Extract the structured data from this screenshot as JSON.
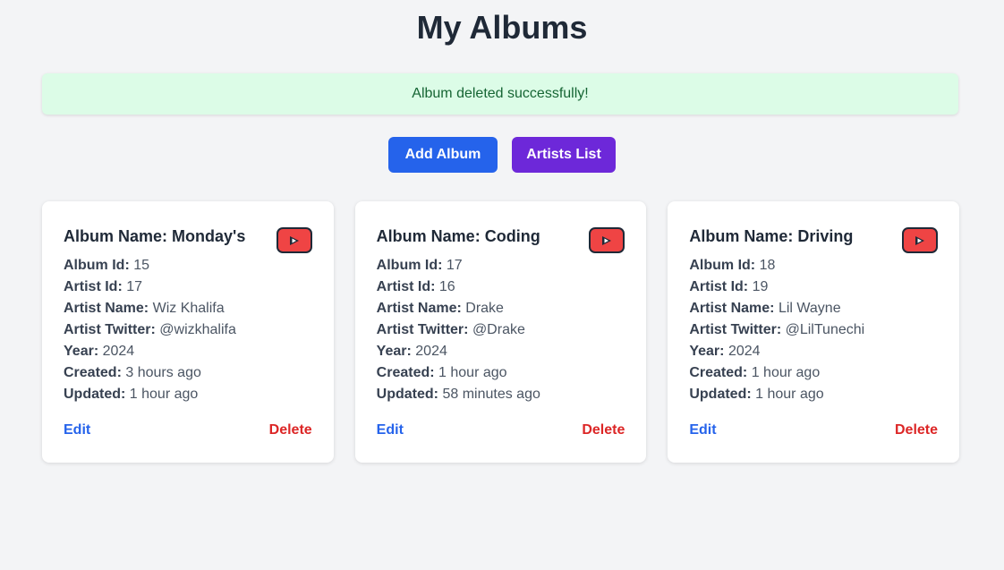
{
  "header": {
    "title": "My Albums"
  },
  "alert": {
    "message": "Album deleted successfully!"
  },
  "actions": {
    "add_album": "Add Album",
    "artists_list": "Artists List"
  },
  "labels": {
    "album_name": "Album Name:",
    "album_id": "Album Id:",
    "artist_id": "Artist Id:",
    "artist_name": "Artist Name:",
    "artist_twitter": "Artist Twitter:",
    "year": "Year:",
    "created": "Created:",
    "updated": "Updated:",
    "edit": "Edit",
    "delete": "Delete"
  },
  "albums": [
    {
      "name": "Monday's",
      "album_id": "15",
      "artist_id": "17",
      "artist_name": "Wiz Khalifa",
      "artist_twitter": "@wizkhalifa",
      "year": "2024",
      "created": "3 hours ago",
      "updated": "1 hour ago"
    },
    {
      "name": "Coding",
      "album_id": "17",
      "artist_id": "16",
      "artist_name": "Drake",
      "artist_twitter": "@Drake",
      "year": "2024",
      "created": "1 hour ago",
      "updated": "58 minutes ago"
    },
    {
      "name": "Driving",
      "album_id": "18",
      "artist_id": "19",
      "artist_name": "Lil Wayne",
      "artist_twitter": "@LilTunechi",
      "year": "2024",
      "created": "1 hour ago",
      "updated": "1 hour ago"
    }
  ],
  "colors": {
    "background": "#f3f4f6",
    "alert_bg": "#dcfce7",
    "alert_text": "#166534",
    "primary": "#2563eb",
    "secondary": "#6d28d9",
    "danger": "#dc2626",
    "youtube": "#ef4444"
  },
  "icons": {
    "youtube": "youtube-icon"
  }
}
